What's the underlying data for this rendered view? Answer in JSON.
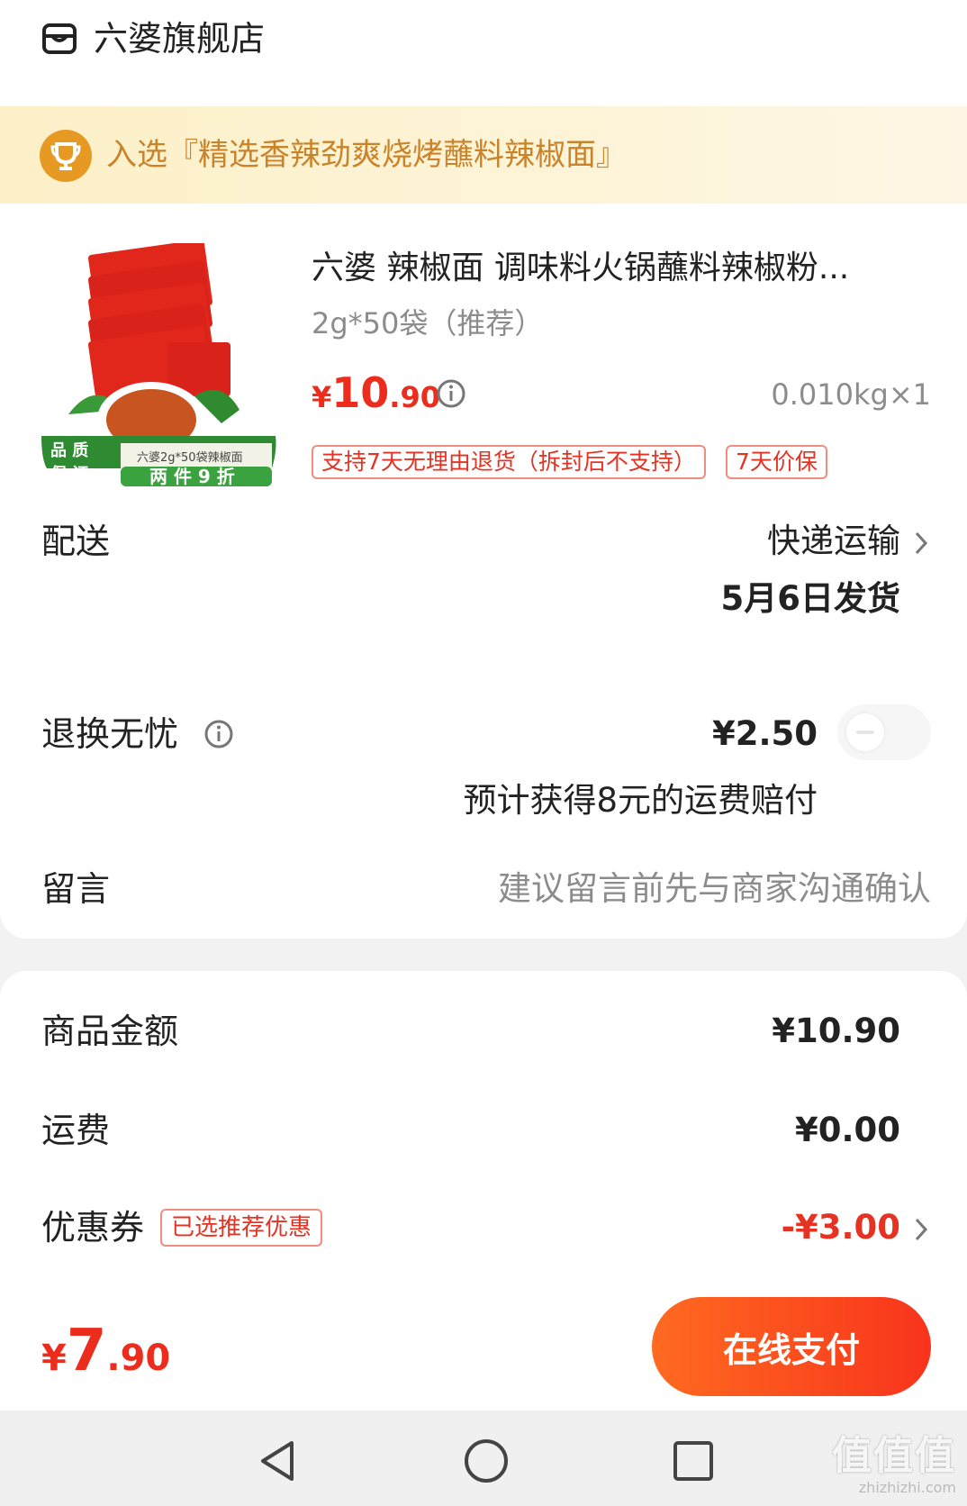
{
  "store": {
    "name": "六婆旗舰店",
    "icon": "store-icon"
  },
  "award": {
    "text": "入选『精选香辣劲爽烧烤蘸料辣椒面』",
    "icon": "trophy-icon"
  },
  "product": {
    "title": "六婆 辣椒面 调味料火锅蘸料辣椒粉...",
    "spec": "2g*50袋（推荐）",
    "price": {
      "currency": "¥",
      "integer": "10",
      "decimal": ".90"
    },
    "weight_qty": "0.010kg×1",
    "tags": [
      "支持7天无理由退货（拆封后不支持）",
      "7天价保"
    ],
    "image_texts": {
      "quality": "品质保证",
      "pack_label": "六婆2g*50袋辣椒面",
      "promo": "两件9折"
    }
  },
  "delivery": {
    "label": "配送",
    "method": "快递运输",
    "ship_date": "5月6日发货"
  },
  "return_insurance": {
    "label": "退换无忧",
    "price": "¥2.50",
    "note": "预计获得8元的运费赔付",
    "enabled": false
  },
  "message": {
    "label": "留言",
    "placeholder": "建议留言前先与商家沟通确认"
  },
  "summary": {
    "goods_label": "商品金额",
    "goods_value": "¥10.90",
    "shipping_label": "运费",
    "shipping_value": "¥0.00",
    "coupon_label": "优惠券",
    "coupon_badge": "已选推荐优惠",
    "coupon_value": "-¥3.00"
  },
  "pay": {
    "currency": "¥",
    "integer": "7",
    "decimal": ".90",
    "button": "在线支付"
  },
  "colors": {
    "accent": "#ec2c1c",
    "banner_text": "#c9832a",
    "banner_bg": "#fdf0c8",
    "pay_button": "#f8341c"
  },
  "watermark": {
    "main": "值值值",
    "sub": "zhizhizhi.com"
  }
}
